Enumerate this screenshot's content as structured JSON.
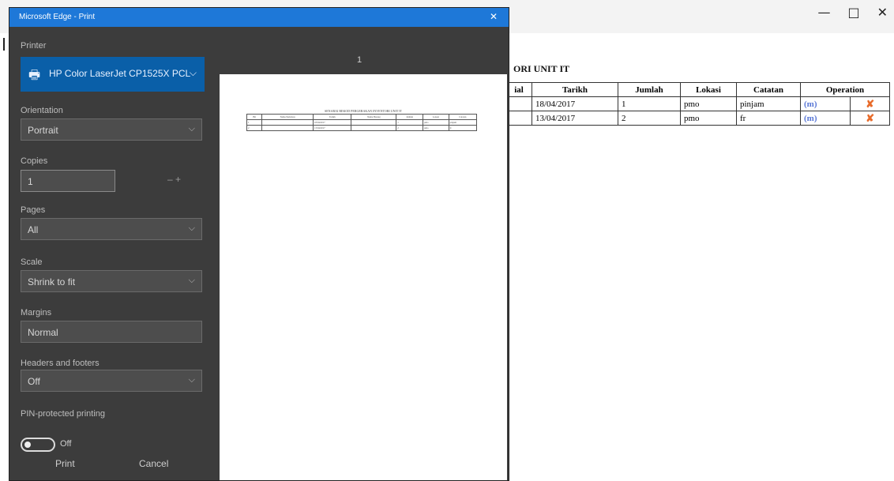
{
  "window": {
    "title": "Microsoft Edge - Print",
    "controls": [
      "—",
      "□",
      "✕"
    ]
  },
  "background_page": {
    "title": "ORI UNIT IT",
    "table": {
      "headers": [
        "ial",
        "Tarikh",
        "Jumlah",
        "Lokasi",
        "Catatan",
        "Operation"
      ],
      "rows": [
        {
          "c0": "",
          "tarikh": "18/04/2017",
          "jumlah": "1",
          "lokasi": "pmo",
          "catatan": "pinjam",
          "view": "(m)",
          "del": "✘"
        },
        {
          "c0": "",
          "tarikh": "13/04/2017",
          "jumlah": "2",
          "lokasi": "pmo",
          "catatan": "fr",
          "view": "(m)",
          "del": "✘"
        }
      ]
    }
  },
  "print_dialog": {
    "printer_label": "Printer",
    "printer_name": "HP Color LaserJet CP1525X PCL",
    "orientation_label": "Orientation",
    "orientation_value": "Portrait",
    "copies_label": "Copies",
    "copies_value": "1",
    "copies_step": "–   +",
    "pages_label": "Pages",
    "pages_value": "All",
    "scale_label": "Scale",
    "scale_value": "Shrink to fit",
    "margins_label": "Margins",
    "margins_value": "Normal",
    "headers_label": "Headers and footers",
    "headers_value": "Off",
    "pin_label": "PIN-protected printing",
    "pin_value": "Off",
    "page_count": "1",
    "buttons": {
      "print": "Print",
      "cancel": "Cancel"
    }
  },
  "preview": {
    "title": "SENARAI REKOD PERGERAKAN INVENTORI UNIT IT",
    "headers": [
      "Bil",
      "Nama Pemohon",
      "Tarikh",
      "Nama Barang",
      "Jumlah",
      "Lokasi",
      "Catatan"
    ],
    "rows": [
      [
        "1",
        "",
        "18/04/2017",
        "",
        "1",
        "pmo",
        "pinjam"
      ],
      [
        "2",
        "",
        "13/04/2017",
        "",
        "2",
        "pmo",
        "fr"
      ]
    ]
  },
  "colors": {
    "dialog_bg": "#3c3c3c",
    "title_bar": "#1e78d8",
    "printer_select": "#0a5fa8"
  },
  "icons": [
    "printer-icon",
    "chevron-down-icon",
    "close-icon",
    "view-icon",
    "delete-icon"
  ]
}
